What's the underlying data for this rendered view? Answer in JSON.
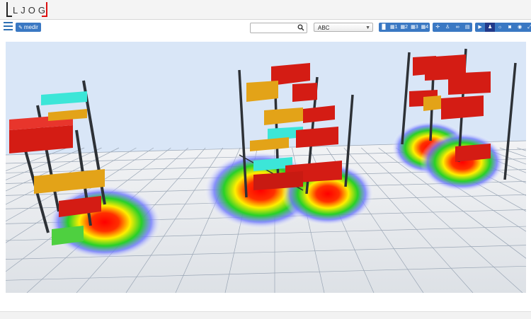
{
  "app": {
    "logo_text": "LJOG",
    "brand_colors": {
      "accent": "#3a78c3",
      "logo_dark": "#222222",
      "logo_red": "#dd1111"
    }
  },
  "toolbar": {
    "menu_icon": "hamburger-icon",
    "medir_label": "medir",
    "search": {
      "value": "",
      "placeholder": "",
      "icon": "search-icon"
    },
    "layer_select": {
      "selected": "ABC"
    },
    "view_buttons": [
      {
        "icon": "bar-chart-icon",
        "label": ""
      },
      {
        "icon": "grid-1-icon",
        "label": "1"
      },
      {
        "icon": "grid-2-icon",
        "label": "2"
      },
      {
        "icon": "grid-3-icon",
        "label": "3"
      },
      {
        "icon": "grid-4-icon",
        "label": "4"
      }
    ],
    "tool_buttons": [
      {
        "icon": "move-icon"
      },
      {
        "icon": "person-icon"
      },
      {
        "icon": "link-icon"
      },
      {
        "icon": "book-icon"
      }
    ],
    "media_buttons": [
      {
        "icon": "play-icon"
      },
      {
        "icon": "walk-icon"
      },
      {
        "icon": "bulb-icon"
      },
      {
        "icon": "camera-icon"
      },
      {
        "icon": "eye-icon"
      },
      {
        "icon": "expand-icon"
      }
    ]
  },
  "scene": {
    "heatmap_colors": [
      "#ff0000",
      "#ffff00",
      "#00d000",
      "#4060ff"
    ],
    "floor_color": "#e4e8ee",
    "pallet_colors": {
      "red": "#d41c14",
      "yellow": "#e3a318",
      "cyan": "#3ce6d8"
    }
  }
}
